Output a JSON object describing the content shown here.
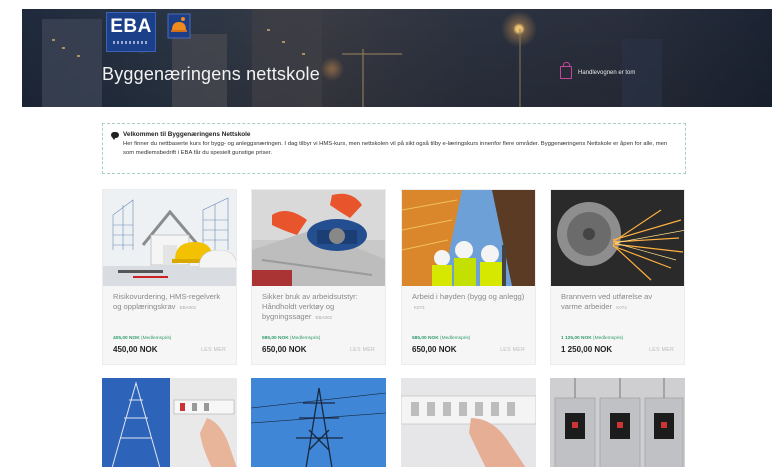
{
  "header": {
    "logo_text": "EBA",
    "title": "Byggenæringens nettskole",
    "cart_label": "Handlevognen er tom",
    "icons": {
      "logo": "eba-logo",
      "badge": "helmet-icon",
      "cart": "shopping-bag-icon"
    }
  },
  "welcome": {
    "title": "Velkommen til Byggenæringens Nettskole",
    "text": "Her finner du nettbaserte kurs for bygg- og anleggsnæringen. I dag tilbyr vi HMS-kurs, men nettskolen vil på sikt også tilby e-læringskurs innenfor flere områder. Byggenæringens Nettskole er åpen for alle, men som medlemsbedrift i EBA får du spesielt gunstige priser."
  },
  "products": [
    {
      "name": "Risikovurdering, HMS-regelverk og opplæringskrav",
      "code": "EBA001",
      "member_price": "405,00 NOK",
      "member_label": "(Medlemspris)",
      "price": "450,00 NOK",
      "more": "LES MER"
    },
    {
      "name": "Sikker bruk av arbeidsutstyr: Håndholdt verktøy og bygningssager",
      "code": "EBA002",
      "member_price": "585,00 NOK",
      "member_label": "(Medlemspris)",
      "price": "650,00 NOK",
      "more": "LES MER"
    },
    {
      "name": "Arbeid i høyden (bygg og anlegg)",
      "code": "K073",
      "member_price": "585,00 NOK",
      "member_label": "(Medlemspris)",
      "price": "650,00 NOK",
      "more": "LES MER"
    },
    {
      "name": "Brannvern ved utførelse av varme arbeider",
      "code": "K074",
      "member_price": "1 125,00 NOK",
      "member_label": "(Medlemspris)",
      "price": "1 250,00 NOK",
      "more": "LES MER"
    }
  ],
  "colors": {
    "accent_green": "#2e9b6c",
    "cart_pink": "#c8469a",
    "logo_blue": "#1c3f8a"
  }
}
